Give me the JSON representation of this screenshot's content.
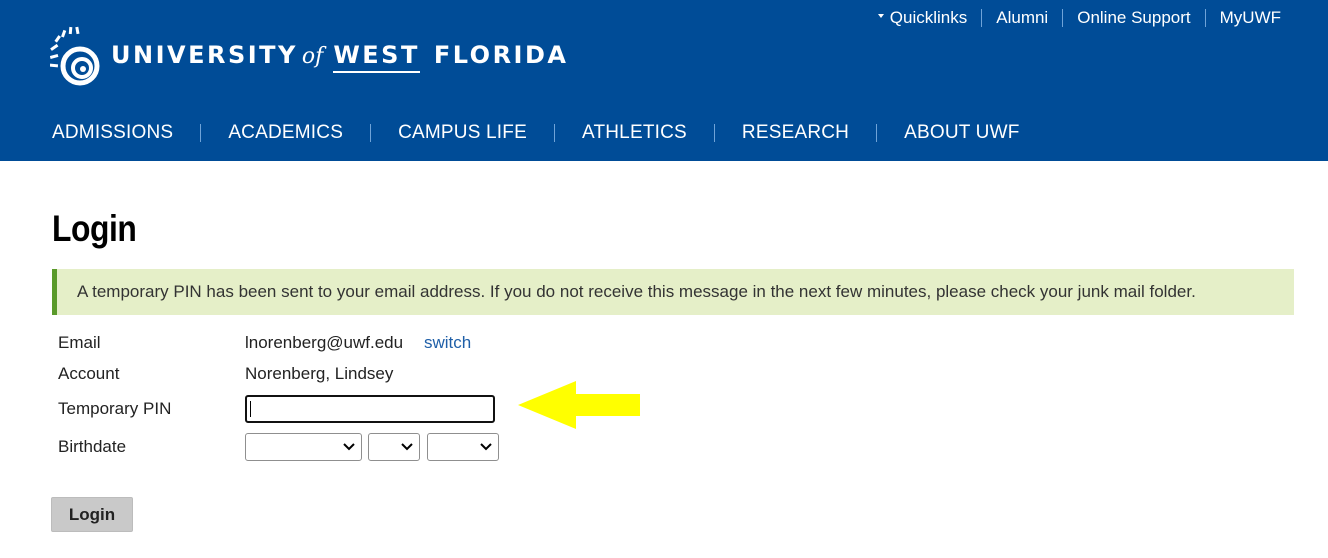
{
  "header": {
    "logo": {
      "text_main": "UNIVERSITY",
      "text_of": "of",
      "text_west": "WEST",
      "text_florida": "FLORIDA",
      "icon": "uwf-logo-icon"
    },
    "quicklinks": [
      {
        "label": "Quicklinks",
        "icon": "caret-down-icon"
      },
      {
        "label": "Alumni"
      },
      {
        "label": "Online Support"
      },
      {
        "label": "MyUWF"
      }
    ],
    "nav": [
      "ADMISSIONS",
      "ACADEMICS",
      "CAMPUS LIFE",
      "ATHLETICS",
      "RESEARCH",
      "ABOUT UWF"
    ]
  },
  "page": {
    "title": "Login",
    "alert": "A temporary PIN has been sent to your email address. If you do not receive this message in the next few minutes, please check your junk mail folder.",
    "form": {
      "email_label": "Email",
      "email_value": "lnorenberg@uwf.edu",
      "switch_label": "switch",
      "account_label": "Account",
      "account_value": "Norenberg, Lindsey",
      "pin_label": "Temporary PIN",
      "pin_value": "",
      "birthdate_label": "Birthdate",
      "birthdate_month": "",
      "birthdate_day": "",
      "birthdate_year": "",
      "submit_label": "Login"
    }
  },
  "colors": {
    "header_bg": "#004c97",
    "alert_bg": "#e5efc8",
    "alert_border": "#5a9a2a",
    "link": "#1f5fa8",
    "annotation_arrow": "#ffff00"
  }
}
